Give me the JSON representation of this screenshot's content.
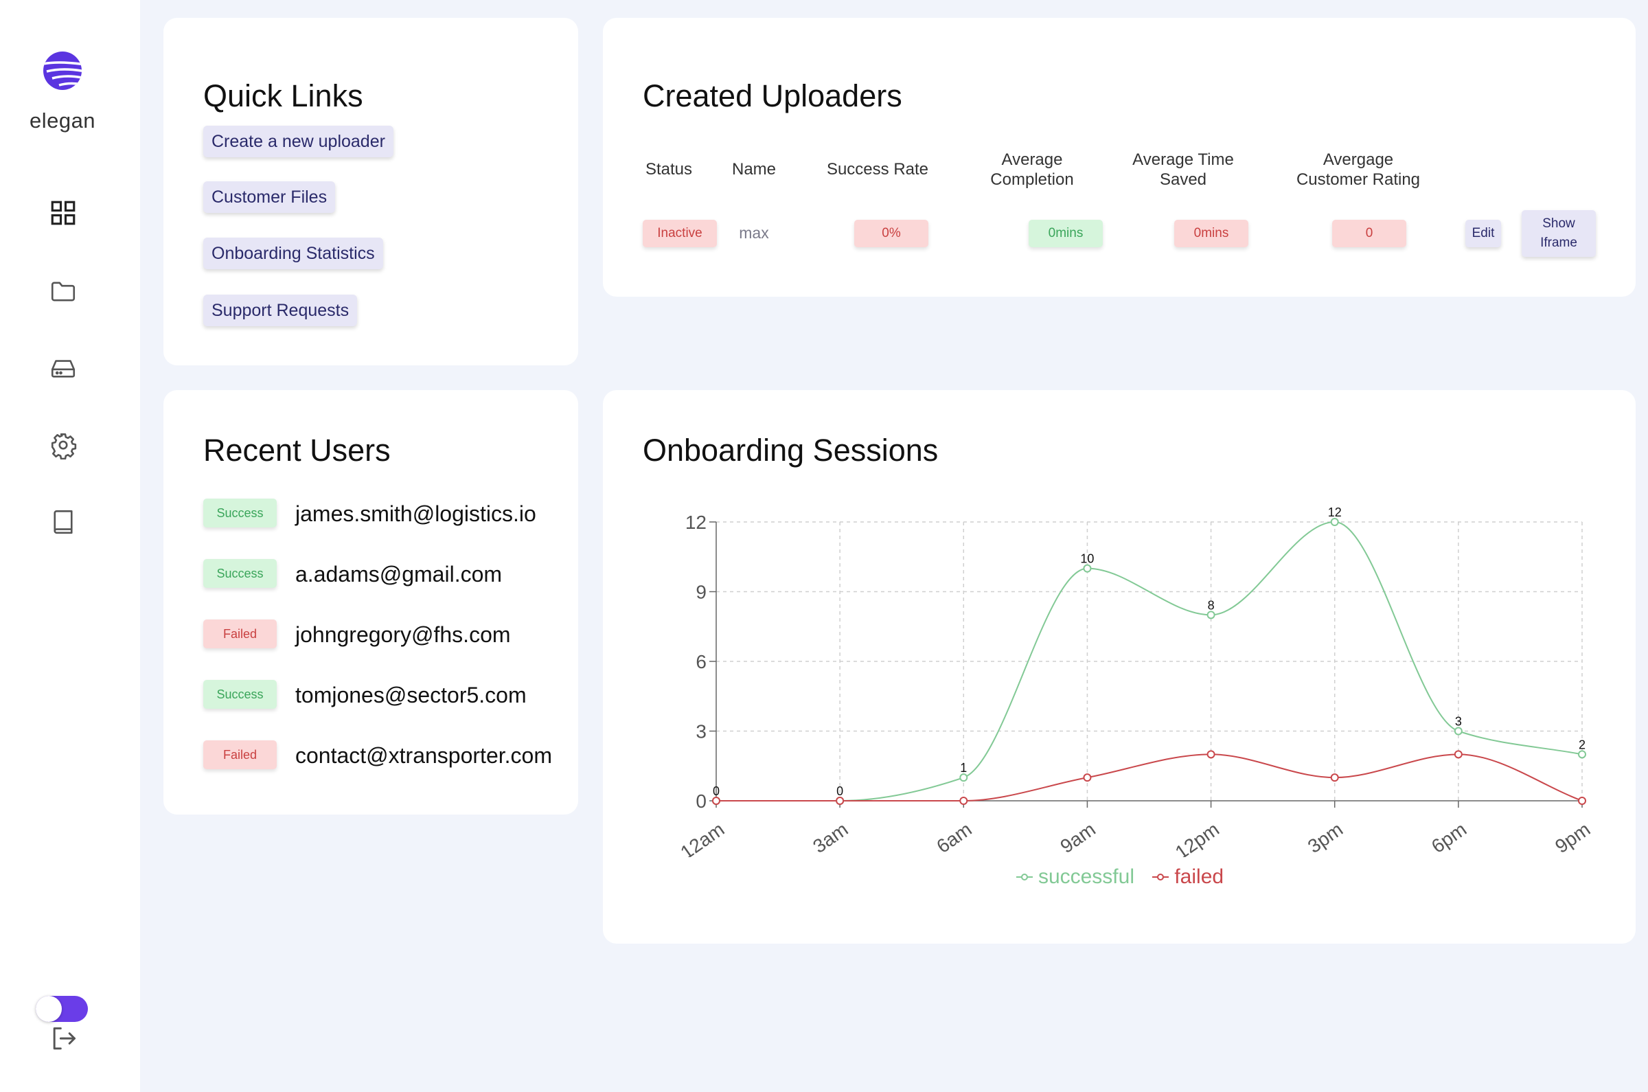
{
  "app": {
    "brand": "elegan"
  },
  "sidebar": {
    "icons": [
      "dashboard-icon",
      "folder-icon",
      "drive-icon",
      "gear-icon",
      "book-icon"
    ],
    "toggle_on": true
  },
  "quick_links": {
    "title": "Quick Links",
    "items": [
      "Create a new uploader",
      "Customer Files",
      "Onboarding Statistics",
      "Support Requests"
    ]
  },
  "uploaders": {
    "title": "Created Uploaders",
    "headers": {
      "status": "Status",
      "name": "Name",
      "success_rate": "Success Rate",
      "avg_completion_1": "Average",
      "avg_completion_2": "Completion",
      "avg_time_1": "Average Time",
      "avg_time_2": "Saved",
      "avg_rating_1": "Avergage",
      "avg_rating_2": "Customer Rating"
    },
    "rows": [
      {
        "status": "Inactive",
        "name": "max",
        "success_rate": "0%",
        "avg_completion": "0mins",
        "avg_time_saved": "0mins",
        "avg_rating": "0",
        "edit_label": "Edit",
        "show_iframe_1": "Show",
        "show_iframe_2": "Iframe"
      }
    ]
  },
  "recent_users": {
    "title": "Recent Users",
    "items": [
      {
        "status": "Success",
        "email": "james.smith@logistics.io"
      },
      {
        "status": "Success",
        "email": "a.adams@gmail.com"
      },
      {
        "status": "Failed",
        "email": "johngregory@fhs.com"
      },
      {
        "status": "Success",
        "email": "tomjones@sector5.com"
      },
      {
        "status": "Failed",
        "email": "contact@xtransporter.com"
      }
    ]
  },
  "sessions": {
    "title": "Onboarding Sessions"
  },
  "chart_data": {
    "type": "line",
    "categories": [
      "12am",
      "3am",
      "6am",
      "9am",
      "12pm",
      "3pm",
      "6pm",
      "9pm"
    ],
    "series": [
      {
        "name": "successful",
        "color": "#82c995",
        "values": [
          0,
          0,
          1,
          10,
          8,
          12,
          3,
          2
        ],
        "labeled": true
      },
      {
        "name": "failed",
        "color": "#c9474b",
        "values": [
          0,
          0,
          0,
          1,
          2,
          1,
          2,
          0
        ],
        "labeled": false
      }
    ],
    "yticks": [
      0,
      3,
      6,
      9,
      12
    ],
    "ylim": [
      0,
      12
    ],
    "grid": true,
    "legend": "bottom-center"
  }
}
